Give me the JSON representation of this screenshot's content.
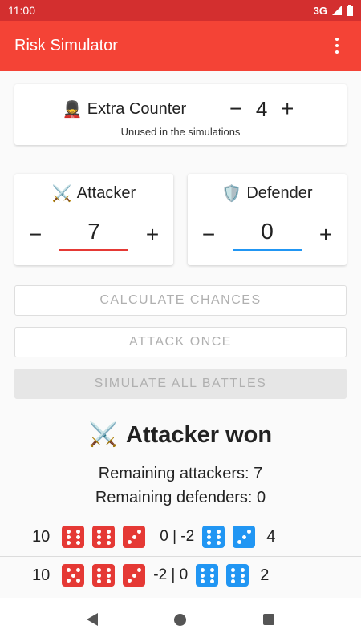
{
  "status": {
    "time": "11:00",
    "network": "3G"
  },
  "app": {
    "title": "Risk Simulator"
  },
  "extra": {
    "emoji": "💂",
    "title": "Extra Counter",
    "value": "4",
    "minus": "−",
    "plus": "+",
    "subtitle": "Unused in the simulations"
  },
  "attacker": {
    "emoji": "⚔️",
    "title": "Attacker",
    "value": "7",
    "minus": "−",
    "plus": "+"
  },
  "defender": {
    "emoji": "🛡️",
    "title": "Defender",
    "value": "0",
    "minus": "−",
    "plus": "+"
  },
  "buttons": {
    "calculate": "CALCULATE CHANCES",
    "attack": "ATTACK ONCE",
    "simulate": "SIMULATE ALL BATTLES"
  },
  "result": {
    "emoji": "⚔️",
    "title": "Attacker won",
    "remaining_attackers": "Remaining attackers: 7",
    "remaining_defenders": "Remaining defenders: 0"
  },
  "rolls": [
    {
      "attackers": "10",
      "score": "0 | -2",
      "defenders": "4",
      "red_dice": [
        6,
        6,
        3
      ],
      "blue_dice": [
        6,
        3
      ]
    },
    {
      "attackers": "10",
      "score": "-2 | 0",
      "defenders": "2",
      "red_dice": [
        5,
        6,
        3
      ],
      "blue_dice": [
        6,
        6
      ]
    }
  ],
  "colors": {
    "app_bar": "#f44336",
    "status_bar": "#d32f2f",
    "attacker": "#e53935",
    "defender": "#2196f3"
  }
}
